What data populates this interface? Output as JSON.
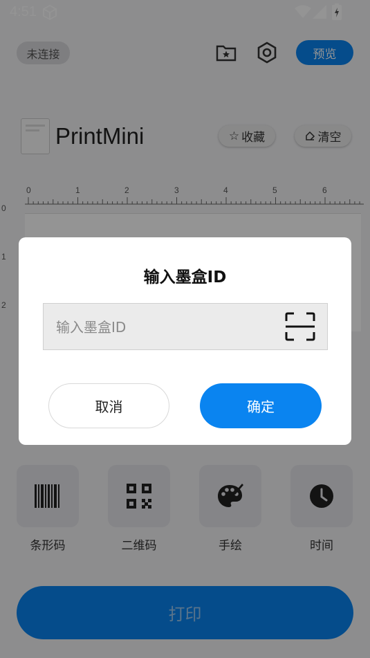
{
  "status_bar": {
    "time": "4:51"
  },
  "header": {
    "connection_status": "未连接",
    "preview_label": "预览"
  },
  "template": {
    "name": "PrintMini",
    "favorite_label": "收藏",
    "clear_label": "清空"
  },
  "ruler": {
    "horizontal_ticks": [
      "0",
      "1",
      "2",
      "3",
      "4",
      "5",
      "6"
    ],
    "vertical_ticks": [
      "0",
      "1",
      "2"
    ]
  },
  "tools": [
    {
      "label": "条形码",
      "icon": "barcode-icon"
    },
    {
      "label": "二维码",
      "icon": "qr-code-icon"
    },
    {
      "label": "手绘",
      "icon": "palette-icon"
    },
    {
      "label": "时间",
      "icon": "clock-icon"
    }
  ],
  "print_label": "打印",
  "dialog": {
    "title": "输入墨盒ID",
    "input_placeholder": "输入墨盒ID",
    "input_value": "",
    "cancel_label": "取消",
    "confirm_label": "确定"
  },
  "colors": {
    "accent": "#0a84f0",
    "accent_dark": "#0758a3",
    "overlay": "rgba(0,0,0,0.42)"
  }
}
